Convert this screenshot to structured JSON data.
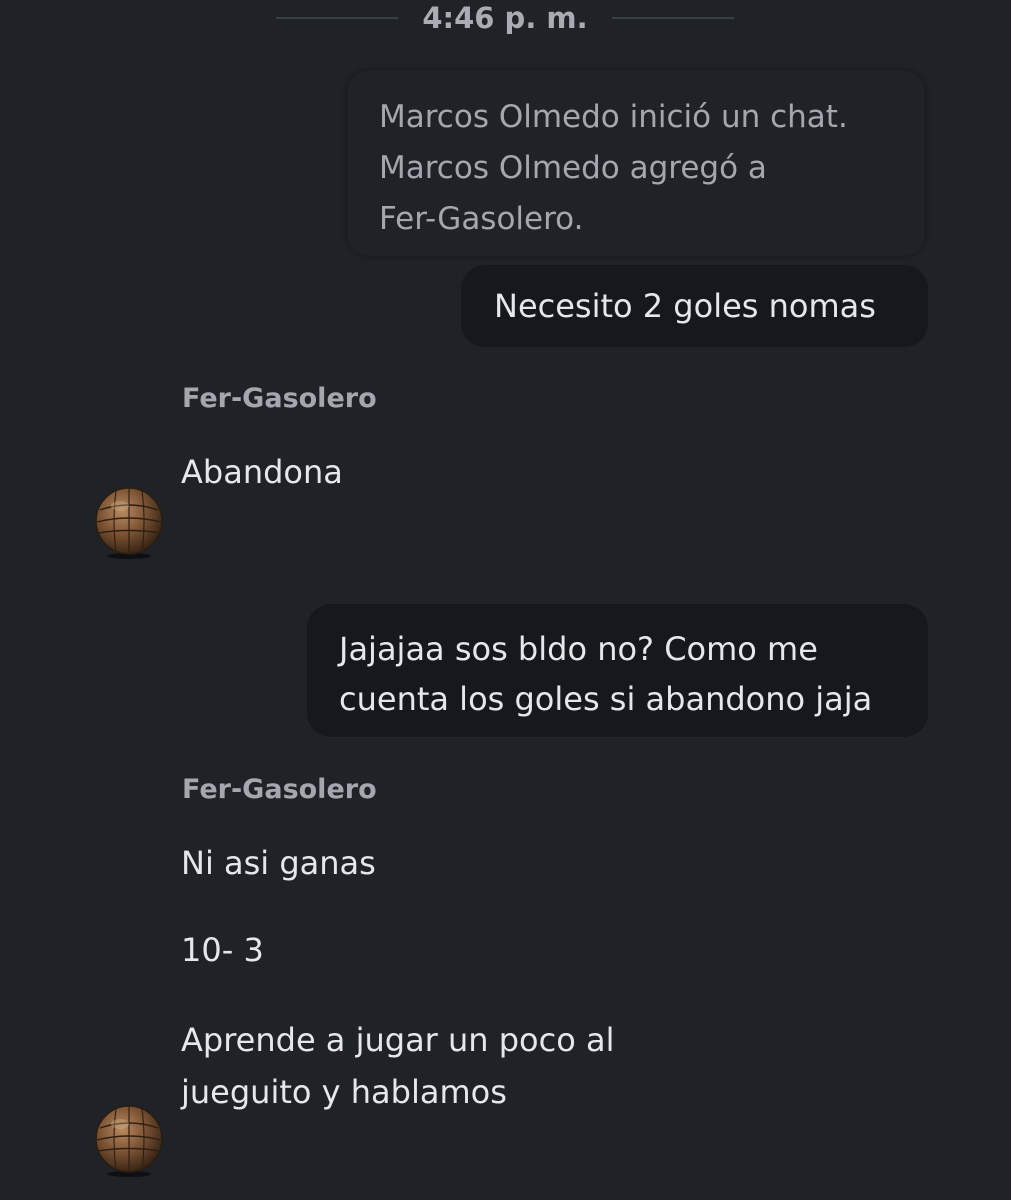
{
  "divider": {
    "time": "4:46 p. m."
  },
  "system_message": {
    "lines": [
      "Marcos Olmedo inició un chat.",
      "Marcos Olmedo agregó a",
      "Fer-Gasolero."
    ]
  },
  "messages": [
    {
      "type": "outgoing",
      "lines": [
        "Necesito 2 goles nomas"
      ]
    },
    {
      "type": "incoming",
      "sender": "Fer-Gasolero",
      "lines": [
        "Abandona"
      ]
    },
    {
      "type": "outgoing",
      "lines": [
        "Jajajaa sos bldo no? Como me",
        "cuenta los goles si abandono jaja"
      ]
    },
    {
      "type": "incoming",
      "sender": "Fer-Gasolero",
      "lines": [
        "Ni asi ganas"
      ]
    },
    {
      "type": "incoming",
      "lines": [
        "10- 3"
      ]
    },
    {
      "type": "incoming",
      "lines": [
        "Aprende a jugar un poco al",
        "jueguito y hablamos"
      ]
    }
  ],
  "avatar_icon": "leather-football-icon",
  "colors": {
    "background": "#1f2227",
    "outgoing_bubble": "#15181c",
    "text_primary": "#e6e7ea",
    "text_secondary": "#a4a7ad"
  }
}
